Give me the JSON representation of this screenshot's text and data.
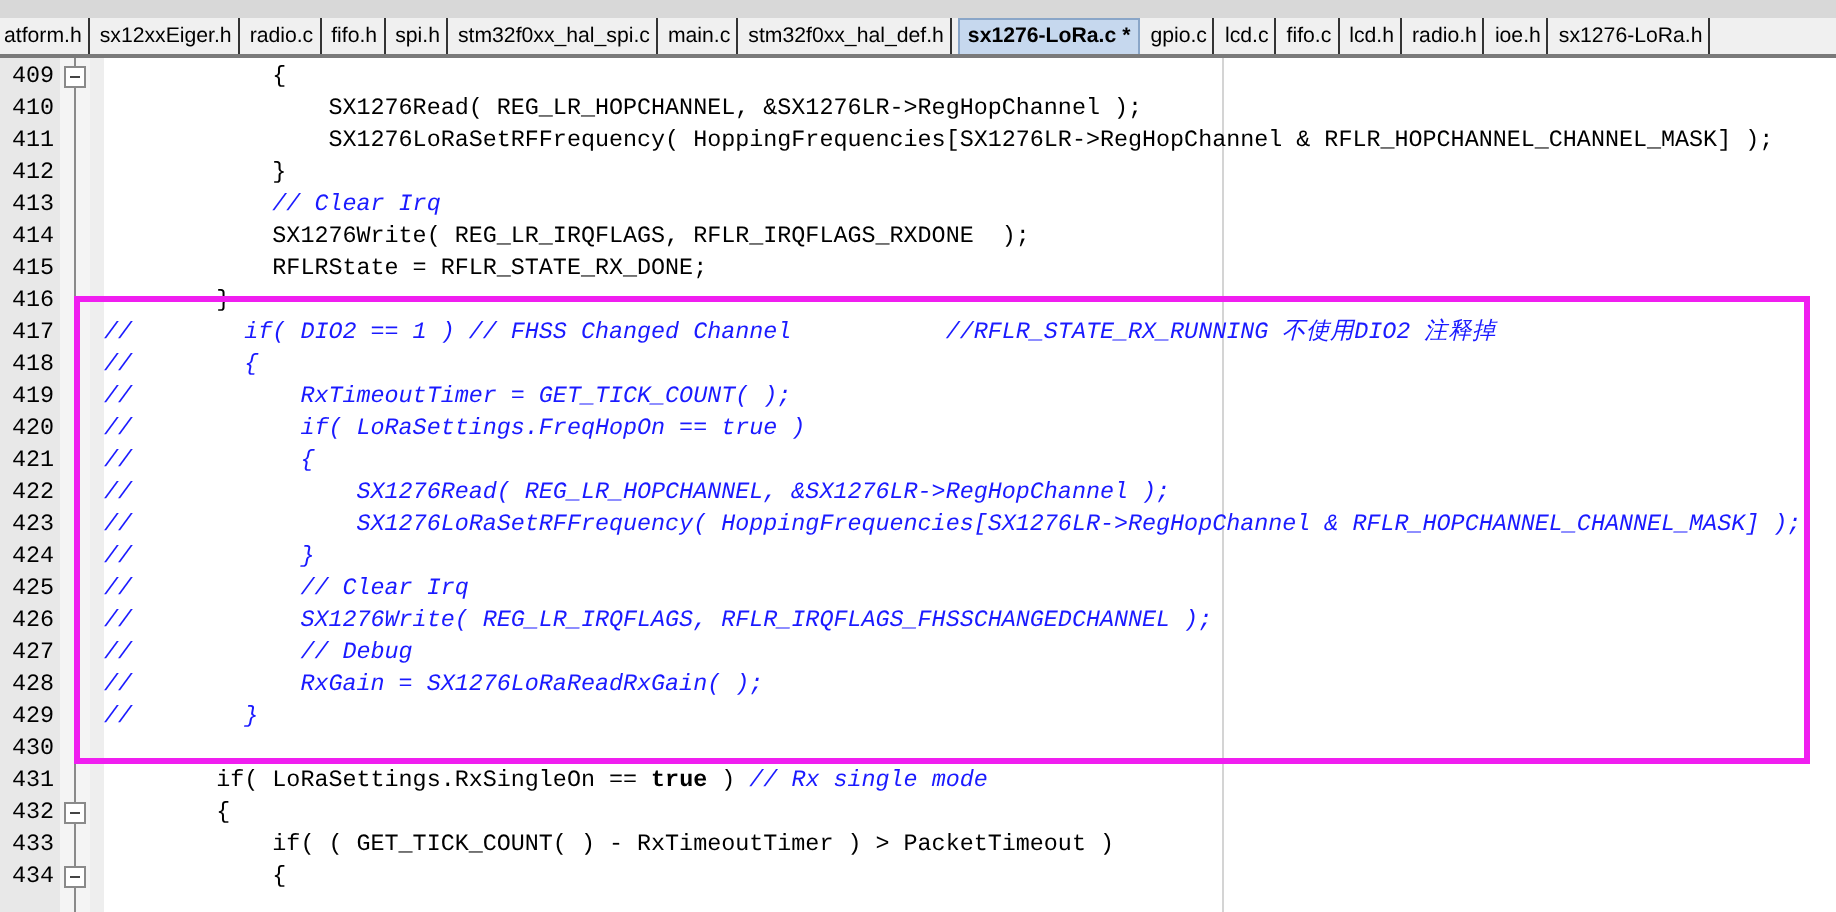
{
  "tabs": [
    {
      "label": "atform.h",
      "selected": false
    },
    {
      "label": "sx12xxEiger.h",
      "selected": false
    },
    {
      "label": "radio.c",
      "selected": false
    },
    {
      "label": "fifo.h",
      "selected": false
    },
    {
      "label": "spi.h",
      "selected": false
    },
    {
      "label": "stm32f0xx_hal_spi.c",
      "selected": false
    },
    {
      "label": "main.c",
      "selected": false
    },
    {
      "label": "stm32f0xx_hal_def.h",
      "selected": false
    },
    {
      "label": "sx1276-LoRa.c *",
      "selected": true
    },
    {
      "label": "gpio.c",
      "selected": false
    },
    {
      "label": "lcd.c",
      "selected": false
    },
    {
      "label": "fifo.c",
      "selected": false
    },
    {
      "label": "lcd.h",
      "selected": false
    },
    {
      "label": "radio.h",
      "selected": false
    },
    {
      "label": "ioe.h",
      "selected": false
    },
    {
      "label": "sx1276-LoRa.h",
      "selected": false
    }
  ],
  "code_blocks": [
    {
      "kind": "plain",
      "lines": [
        {
          "number": "409",
          "collapsible": true,
          "segments": [
            {
              "kind": "code",
              "text": "            {"
            }
          ]
        },
        {
          "number": "410",
          "collapsible": false,
          "segments": [
            {
              "kind": "code",
              "text": "                SX1276Read( REG_LR_HOPCHANNEL, &SX1276LR->RegHopChannel );"
            }
          ]
        },
        {
          "number": "411",
          "collapsible": false,
          "segments": [
            {
              "kind": "code",
              "text": "                SX1276LoRaSetRFFrequency( HoppingFrequencies[SX1276LR->RegHopChannel & RFLR_HOPCHANNEL_CHANNEL_MASK] );"
            }
          ]
        },
        {
          "number": "412",
          "collapsible": false,
          "segments": [
            {
              "kind": "code",
              "text": "            }"
            }
          ]
        },
        {
          "number": "413",
          "collapsible": false,
          "segments": [
            {
              "kind": "comment",
              "text": "            // Clear Irq"
            }
          ]
        },
        {
          "number": "414",
          "collapsible": false,
          "segments": [
            {
              "kind": "code",
              "text": "            SX1276Write( REG_LR_IRQFLAGS, RFLR_IRQFLAGS_RXDONE  );"
            }
          ]
        },
        {
          "number": "415",
          "collapsible": false,
          "segments": [
            {
              "kind": "code",
              "text": "            RFLRState = RFLR_STATE_RX_DONE;"
            }
          ]
        },
        {
          "number": "416",
          "collapsible": false,
          "segments": [
            {
              "kind": "code",
              "text": "        }"
            }
          ]
        }
      ]
    },
    {
      "kind": "highlight",
      "lines": [
        {
          "number": "417",
          "collapsible": false,
          "segments": [
            {
              "kind": "comment",
              "text": "//        if( DIO2 == 1 ) // FHSS Changed Channel           //RFLR_STATE_RX_RUNNING 不使用DIO2 注释掉"
            }
          ]
        },
        {
          "number": "418",
          "collapsible": false,
          "segments": [
            {
              "kind": "comment",
              "text": "//        {"
            }
          ]
        },
        {
          "number": "419",
          "collapsible": false,
          "segments": [
            {
              "kind": "comment",
              "text": "//            RxTimeoutTimer = GET_TICK_COUNT( );"
            }
          ]
        },
        {
          "number": "420",
          "collapsible": false,
          "segments": [
            {
              "kind": "comment",
              "text": "//            if( LoRaSettings.FreqHopOn == true )"
            }
          ]
        },
        {
          "number": "421",
          "collapsible": false,
          "segments": [
            {
              "kind": "comment",
              "text": "//            {"
            }
          ]
        },
        {
          "number": "422",
          "collapsible": false,
          "segments": [
            {
              "kind": "comment",
              "text": "//                SX1276Read( REG_LR_HOPCHANNEL, &SX1276LR->RegHopChannel );"
            }
          ]
        },
        {
          "number": "423",
          "collapsible": false,
          "segments": [
            {
              "kind": "comment",
              "text": "//                SX1276LoRaSetRFFrequency( HoppingFrequencies[SX1276LR->RegHopChannel & RFLR_HOPCHANNEL_CHANNEL_MASK] );"
            }
          ]
        },
        {
          "number": "424",
          "collapsible": false,
          "segments": [
            {
              "kind": "comment",
              "text": "//            }"
            }
          ]
        },
        {
          "number": "425",
          "collapsible": false,
          "segments": [
            {
              "kind": "comment",
              "text": "//            // Clear Irq"
            }
          ]
        },
        {
          "number": "426",
          "collapsible": false,
          "segments": [
            {
              "kind": "comment",
              "text": "//            SX1276Write( REG_LR_IRQFLAGS, RFLR_IRQFLAGS_FHSSCHANGEDCHANNEL );"
            }
          ]
        },
        {
          "number": "427",
          "collapsible": false,
          "segments": [
            {
              "kind": "comment",
              "text": "//            // Debug"
            }
          ]
        },
        {
          "number": "428",
          "collapsible": false,
          "segments": [
            {
              "kind": "comment",
              "text": "//            RxGain = SX1276LoRaReadRxGain( );"
            }
          ]
        },
        {
          "number": "429",
          "collapsible": false,
          "segments": [
            {
              "kind": "comment",
              "text": "//        }"
            }
          ]
        },
        {
          "number": "430",
          "collapsible": false
        }
      ]
    },
    {
      "kind": "plain",
      "lines": [
        {
          "number": "431",
          "collapsible": false,
          "segments": [
            {
              "kind": "code",
              "text": "        if( LoRaSettings.RxSingleOn == "
            },
            {
              "kind": "keyword",
              "text": "true"
            },
            {
              "kind": "code",
              "text": " ) "
            },
            {
              "kind": "comment",
              "text": "// Rx single mode"
            }
          ]
        },
        {
          "number": "432",
          "collapsible": true,
          "segments": [
            {
              "kind": "code",
              "text": "        {"
            }
          ]
        },
        {
          "number": "433",
          "collapsible": false,
          "segments": [
            {
              "kind": "code",
              "text": "            if( ( GET_TICK_COUNT( ) - RxTimeoutTimer ) > PacketTimeout )"
            }
          ]
        },
        {
          "number": "434",
          "collapsible": true,
          "segments": [
            {
              "kind": "code",
              "text": "            {"
            }
          ]
        }
      ]
    }
  ]
}
